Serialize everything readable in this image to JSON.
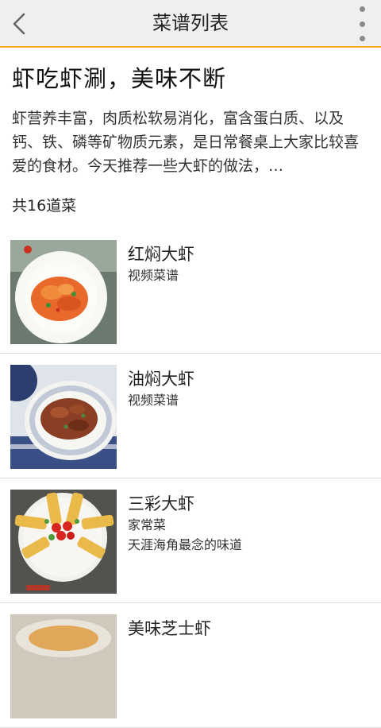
{
  "appbar": {
    "title": "菜谱列表",
    "back_icon": "chevron-left-icon",
    "more_icon": "more-vertical-icon"
  },
  "intro": {
    "heading": "虾吃虾涮，美味不断",
    "description": "虾营养丰富，肉质松软易消化，富含蛋白质、以及钙、铁、磷等矿物质元素，是日常餐桌上大家比较喜爱的食材。今天推荐一些大虾的做法，…",
    "count": "共16道菜"
  },
  "colors": {
    "accent": "#f5a623",
    "appbar_bg": "#efefef",
    "divider": "#dcdcdc"
  },
  "recipes": [
    {
      "name": "红焖大虾",
      "type": "视频菜谱",
      "subtitle": "",
      "thumb": "braised-shrimp-image"
    },
    {
      "name": "油焖大虾",
      "type": "视频菜谱",
      "subtitle": "",
      "thumb": "oil-braised-shrimp-image"
    },
    {
      "name": "三彩大虾",
      "type": "家常菜",
      "subtitle": "天涯海角最念的味道",
      "thumb": "tricolor-shrimp-image"
    },
    {
      "name": "美味芝士虾",
      "type": "",
      "subtitle": "",
      "thumb": "cheese-shrimp-image"
    }
  ]
}
